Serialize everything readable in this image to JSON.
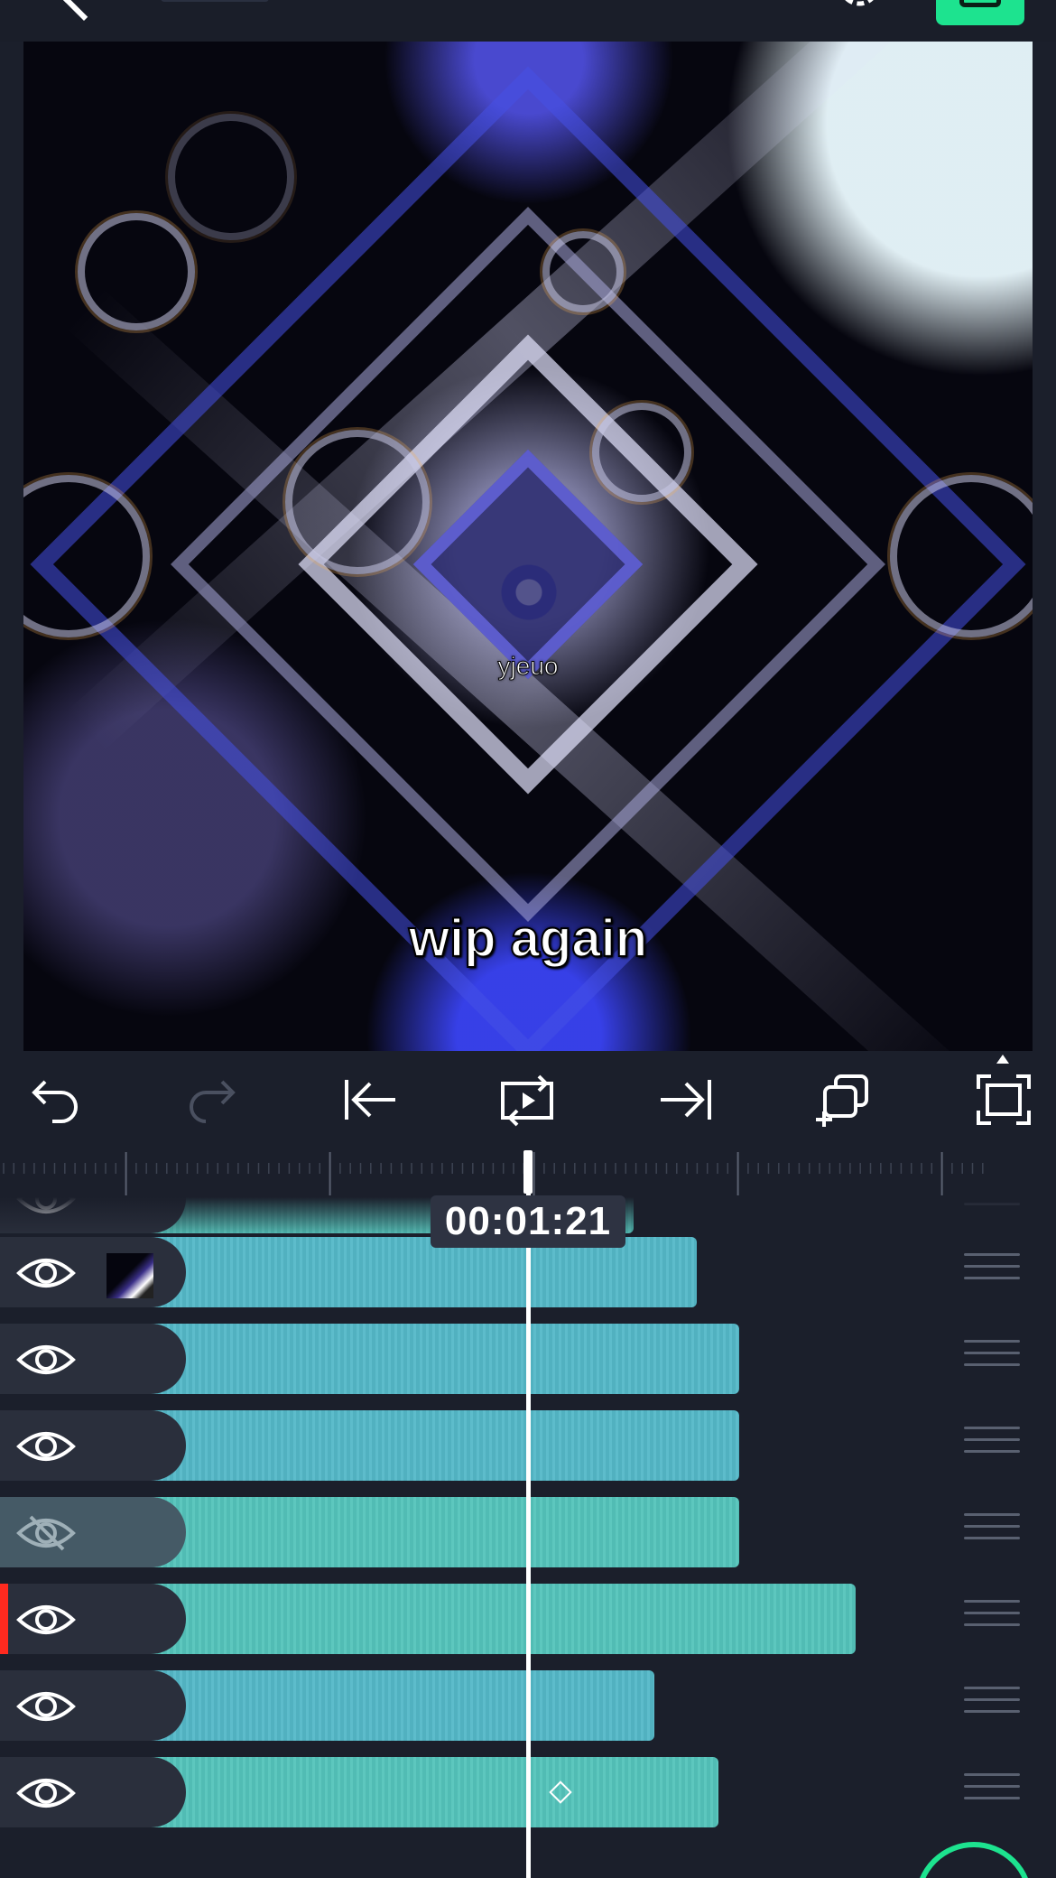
{
  "preview": {
    "small_caption": "yjeuo",
    "main_caption": "wip again"
  },
  "playhead": {
    "timecode": "00:01:21"
  },
  "tracks": [
    {
      "visible": true,
      "clip_color": "#54c4bb",
      "clip_end_fraction": 0.6
    },
    {
      "visible": true,
      "clip_color": "#54b8c8",
      "clip_end_fraction": 0.66,
      "has_thumbnail": true
    },
    {
      "visible": true,
      "clip_color": "#54b8c8",
      "clip_end_fraction": 0.7
    },
    {
      "visible": true,
      "clip_color": "#54b8c8",
      "clip_end_fraction": 0.7
    },
    {
      "visible": false,
      "clip_color": "#54c4bb",
      "clip_end_fraction": 0.7
    },
    {
      "visible": true,
      "clip_color": "#54c4bb",
      "clip_end_fraction": 0.81,
      "selected": true
    },
    {
      "visible": true,
      "clip_color": "#54b8c8",
      "clip_end_fraction": 0.62
    },
    {
      "visible": true,
      "clip_color": "#54c4bb",
      "clip_end_fraction": 0.68,
      "has_keyframe": true
    }
  ],
  "colors": {
    "accent": "#1de38f",
    "background": "#1b1f2b",
    "selection": "#ff2a1f"
  }
}
